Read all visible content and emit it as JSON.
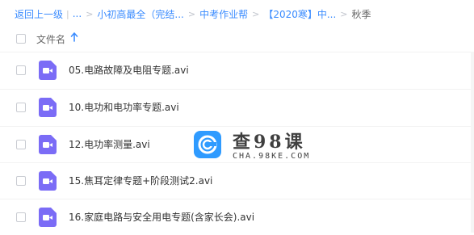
{
  "breadcrumb": {
    "back_label": "返回上一级",
    "ellipsis": "...",
    "items": [
      "小初高最全（完结...",
      "中考作业帮",
      "【2020寒】中...",
      "秋季"
    ]
  },
  "header": {
    "name_column": "文件名"
  },
  "files": [
    {
      "name": "05.电路故障及电阻专题.avi"
    },
    {
      "name": "10.电功和电功率专题.avi"
    },
    {
      "name": "12.电功率测量.avi"
    },
    {
      "name": "15.焦耳定律专题+阶段测试2.avi"
    },
    {
      "name": "16.家庭电路与安全用电专题(含家长会).avi"
    }
  ],
  "watermark": {
    "title": "查98课",
    "subtitle": "CHA.98KE.COM"
  },
  "colors": {
    "link": "#3b8cff",
    "file_icon": "#7b6cf6",
    "logo": "#2f9bff"
  }
}
